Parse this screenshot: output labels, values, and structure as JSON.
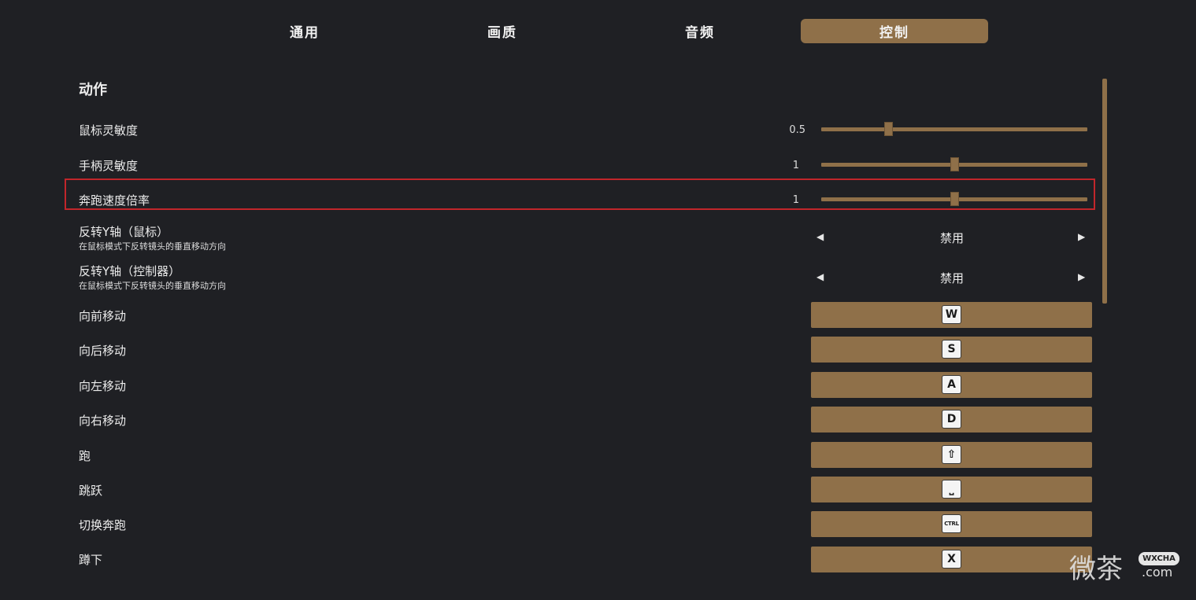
{
  "tabs": [
    {
      "label": "通用",
      "active": false
    },
    {
      "label": "画质",
      "active": false
    },
    {
      "label": "音频",
      "active": false
    },
    {
      "label": "控制",
      "active": true
    }
  ],
  "section": {
    "title": "动作"
  },
  "sliders": [
    {
      "label": "鼠标灵敏度",
      "value_text": "0.5",
      "fraction": 0.25
    },
    {
      "label": "手柄灵敏度",
      "value_text": "1",
      "fraction": 0.5
    },
    {
      "label": "奔跑速度倍率",
      "value_text": "1",
      "fraction": 0.5
    }
  ],
  "options": [
    {
      "label": "反转Y轴（鼠标）",
      "description": "在鼠标模式下反转镜头的垂直移动方向",
      "value": "禁用"
    },
    {
      "label": "反转Y轴（控制器）",
      "description": "在鼠标模式下反转镜头的垂直移动方向",
      "value": "禁用"
    }
  ],
  "keybinds": [
    {
      "label": "向前移动",
      "key": "W"
    },
    {
      "label": "向后移动",
      "key": "S"
    },
    {
      "label": "向左移动",
      "key": "A"
    },
    {
      "label": "向右移动",
      "key": "D"
    },
    {
      "label": "跑",
      "key": "⇧"
    },
    {
      "label": "跳跃",
      "key": "⎵"
    },
    {
      "label": "切换奔跑",
      "key": "CTRL"
    },
    {
      "label": "蹲下",
      "key": "X"
    }
  ],
  "arrows": {
    "left": "◀",
    "right": "▶"
  },
  "watermark": {
    "chinese": "微茶",
    "tag": "WXCHA",
    "domain": ".com"
  },
  "colors": {
    "accent": "#8f7049",
    "background": "#1f2024",
    "highlight": "#c1262b"
  }
}
